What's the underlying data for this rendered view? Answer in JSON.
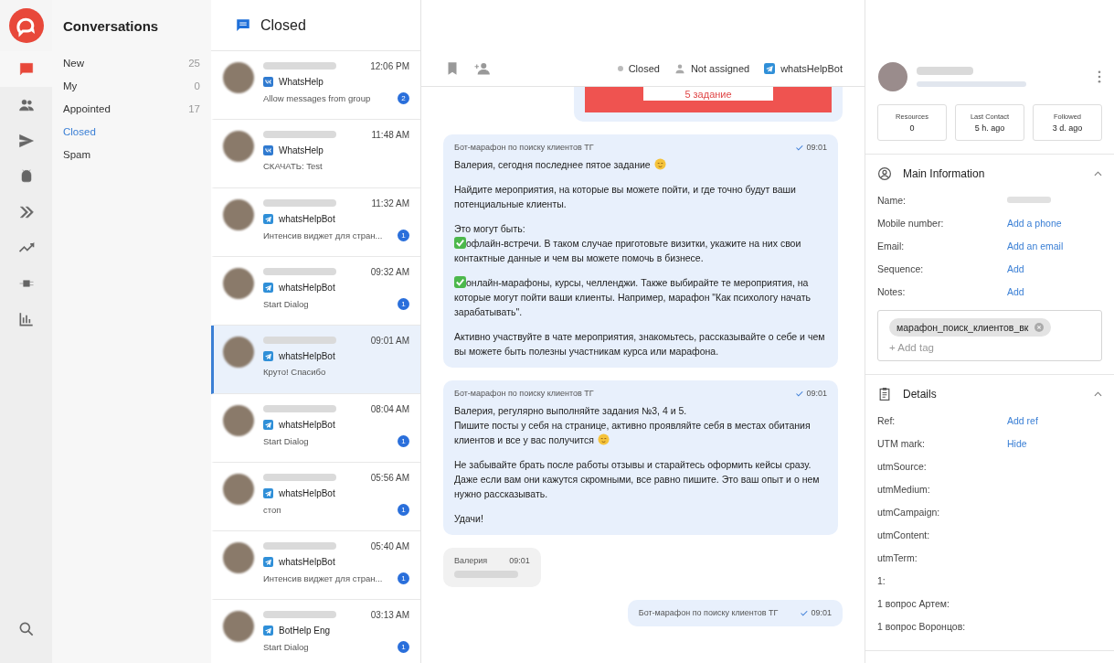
{
  "rail": {
    "items": [
      {
        "selected": true
      },
      {
        "selected": false
      },
      {
        "selected": false
      },
      {
        "selected": false
      },
      {
        "selected": false
      },
      {
        "selected": false
      },
      {
        "selected": false
      },
      {
        "selected": false
      }
    ],
    "bottom": [
      {
        "selected": false
      }
    ]
  },
  "nav": {
    "title": "Conversations",
    "items": [
      {
        "label": "New",
        "count": "25",
        "selected": false
      },
      {
        "label": "My",
        "count": "0",
        "selected": false
      },
      {
        "label": "Appointed",
        "count": "17",
        "selected": false
      },
      {
        "label": "Closed",
        "selected": true
      },
      {
        "label": "Spam",
        "selected": false
      }
    ]
  },
  "list": {
    "title": "Closed",
    "conversations": [
      {
        "time": "12:06 PM",
        "kind": "vk",
        "source": "WhatsHelp",
        "preview": "Allow messages from group",
        "badge": "2",
        "selected": false
      },
      {
        "time": "11:48 AM",
        "kind": "vk",
        "source": "WhatsHelp",
        "preview": "СКАЧАТЬ: Test",
        "selected": false
      },
      {
        "time": "11:32 AM",
        "kind": "telegram",
        "source": "whatsHelpBot",
        "preview": "Интенсив виджет для стран...",
        "badge": "1",
        "selected": false
      },
      {
        "time": "09:32 AM",
        "kind": "telegram",
        "source": "whatsHelpBot",
        "preview": "Start Dialog",
        "badge": "1",
        "selected": false
      },
      {
        "time": "09:01 AM",
        "kind": "telegram",
        "source": "whatsHelpBot",
        "preview": "Круто! Спасибо",
        "selected": true
      },
      {
        "time": "08:04 AM",
        "kind": "telegram",
        "source": "whatsHelpBot",
        "preview": "Start Dialog",
        "badge": "1",
        "selected": false
      },
      {
        "time": "05:56 AM",
        "kind": "telegram",
        "source": "whatsHelpBot",
        "preview": "стоп",
        "badge": "1",
        "selected": false
      },
      {
        "time": "05:40 AM",
        "kind": "telegram",
        "source": "whatsHelpBot",
        "preview": "Интенсив виджет для стран...",
        "badge": "1",
        "selected": false
      },
      {
        "time": "03:13 AM",
        "kind": "telegram",
        "source": "BotHelp Eng",
        "preview": "Start Dialog",
        "badge": "1",
        "selected": false
      }
    ]
  },
  "chat": {
    "status": "Closed",
    "assignee": "Not assigned",
    "bot": "whatsHelpBot",
    "messages": [
      {
        "kind": "card",
        "button": "5 задание"
      },
      {
        "kind": "outgoing",
        "sender": "Бот-марафон по поиску клиентов ТГ",
        "time": "09:01",
        "paragraphs": [
          {
            "text": "Валерия, сегодня последнее пятое задание",
            "smiley": true
          },
          {
            "text": "Найдите мероприятия, на которые вы можете пойти, и где точно будут ваши потенциальные клиенты."
          },
          {
            "lines": [
              {
                "text": "Это могут быть:"
              },
              {
                "text": "офлайн-встречи. В таком случае приготовьте визитки, укажите на них свои контактные данные и чем вы можете помочь в бизнесе.",
                "check": true
              }
            ]
          },
          {
            "text": "онлайн-марафоны, курсы, челленджи. Также выбирайте те мероприятия, на которые могут пойти ваши клиенты. Например, марафон \"Как психологу начать зарабатывать\".",
            "check": true
          },
          {
            "text": "Активно участвуйте в чате мероприятия, знакомьтесь, рассказывайте о себе и чем вы можете быть полезны участникам курса или марафона."
          }
        ]
      },
      {
        "kind": "outgoing",
        "sender": "Бот-марафон по поиску клиентов ТГ",
        "time": "09:01",
        "paragraphs": [
          {
            "lines": [
              {
                "text": "Валерия, регулярно выполняйте задания №3, 4 и 5."
              },
              {
                "text": "Пишите посты у себя на странице, активно проявляйте себя в местах обитания клиентов и все у вас получится",
                "smiley": true
              }
            ]
          },
          {
            "text": "Не забывайте брать после работы отзывы и старайтесь оформить кейсы сразу. Даже если вам они кажутся скромными, все равно пишите. Это ваш опыт и о нем нужно рассказывать."
          },
          {
            "text": "Удачи!"
          }
        ]
      },
      {
        "kind": "incoming",
        "sender": "Валерия",
        "time": "09:01"
      },
      {
        "kind": "outgoing",
        "sender": "Бот-марафон по поиску клиентов ТГ",
        "time": "09:01"
      }
    ]
  },
  "contact": {
    "stats": [
      {
        "label": "Resources",
        "value": "0"
      },
      {
        "label": "Last Contact",
        "value": "5 h. ago"
      },
      {
        "label": "Followed",
        "value": "3 d. ago"
      }
    ],
    "sections": [
      {
        "kind": "main",
        "title": "Main Information",
        "expanded": true,
        "rows": [
          {
            "label": "Name:",
            "kind": "hidden"
          },
          {
            "label": "Mobile number:",
            "link": "Add a phone"
          },
          {
            "label": "Email:",
            "link": "Add an email"
          },
          {
            "label": "Sequence:",
            "link": "Add"
          },
          {
            "label": "Notes:",
            "link": "Add"
          }
        ],
        "tags": [
          "марафон_поиск_клиентов_вк"
        ],
        "add_tag": "+ Add tag"
      },
      {
        "kind": "details",
        "title": "Details",
        "expanded": true,
        "rows": [
          {
            "label": "Ref:",
            "link": "Add ref"
          },
          {
            "label": "UTM mark:",
            "link": "Hide"
          },
          {
            "label": "utmSource:"
          },
          {
            "label": "utmMedium:"
          },
          {
            "label": "utmCampaign:"
          },
          {
            "label": "utmContent:"
          },
          {
            "label": "utmTerm:"
          },
          {
            "label": "1:"
          },
          {
            "label": "1 вопрос Артем:"
          },
          {
            "label": "1 вопрос Воронцов:"
          }
        ]
      }
    ]
  }
}
